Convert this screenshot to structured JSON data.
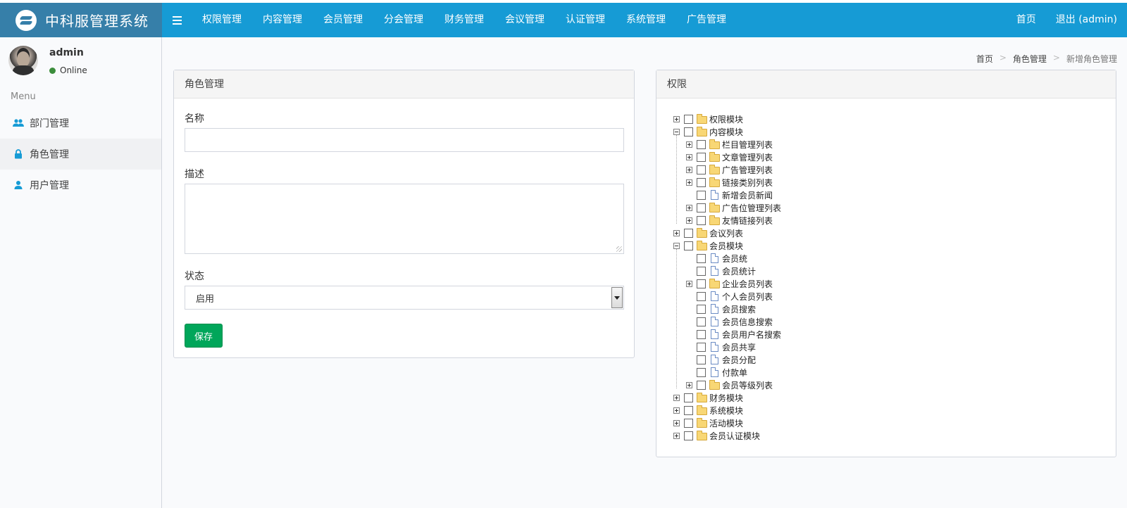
{
  "app": {
    "logo_text": "中科服管理系统"
  },
  "topnav": {
    "items": [
      "权限管理",
      "内容管理",
      "会员管理",
      "分会管理",
      "财务管理",
      "会议管理",
      "认证管理",
      "系统管理",
      "广告管理"
    ],
    "right": [
      "首页",
      "退出 (admin)"
    ]
  },
  "sidebar": {
    "user_name": "admin",
    "user_status": "Online",
    "menu_header": "Menu",
    "items": [
      {
        "label": "部门管理",
        "icon": "users-icon"
      },
      {
        "label": "角色管理",
        "icon": "lock-icon"
      },
      {
        "label": "用户管理",
        "icon": "user-icon"
      }
    ]
  },
  "breadcrumb": [
    "首页",
    "角色管理",
    "新增角色管理"
  ],
  "form": {
    "title": "角色管理",
    "name_label": "名称",
    "name_value": "",
    "desc_label": "描述",
    "desc_value": "",
    "status_label": "状态",
    "status_value": "启用",
    "save_label": "保存"
  },
  "permissions": {
    "title": "权限",
    "tree": [
      {
        "label": "权限模块",
        "type": "folder",
        "level": 0,
        "expander": "plus"
      },
      {
        "label": "内容模块",
        "type": "folder",
        "level": 0,
        "expander": "minus"
      },
      {
        "label": "栏目管理列表",
        "type": "folder",
        "level": 1,
        "expander": "plus"
      },
      {
        "label": "文章管理列表",
        "type": "folder",
        "level": 1,
        "expander": "plus"
      },
      {
        "label": "广告管理列表",
        "type": "folder",
        "level": 1,
        "expander": "plus"
      },
      {
        "label": "链接类别列表",
        "type": "folder",
        "level": 1,
        "expander": "plus"
      },
      {
        "label": "新增会员新闻",
        "type": "file",
        "level": 1,
        "expander": "none"
      },
      {
        "label": "广告位管理列表",
        "type": "folder",
        "level": 1,
        "expander": "plus"
      },
      {
        "label": "友情链接列表",
        "type": "folder",
        "level": 1,
        "expander": "plus"
      },
      {
        "label": "会议列表",
        "type": "folder",
        "level": 0,
        "expander": "plus"
      },
      {
        "label": "会员模块",
        "type": "folder",
        "level": 0,
        "expander": "minus"
      },
      {
        "label": "会员统",
        "type": "file",
        "level": 1,
        "expander": "none"
      },
      {
        "label": "会员统计",
        "type": "file",
        "level": 1,
        "expander": "none"
      },
      {
        "label": "企业会员列表",
        "type": "folder",
        "level": 1,
        "expander": "plus"
      },
      {
        "label": "个人会员列表",
        "type": "file",
        "level": 1,
        "expander": "none"
      },
      {
        "label": "会员搜索",
        "type": "file",
        "level": 1,
        "expander": "none"
      },
      {
        "label": "会员信息搜索",
        "type": "file",
        "level": 1,
        "expander": "none"
      },
      {
        "label": "会员用户名搜索",
        "type": "file",
        "level": 1,
        "expander": "none"
      },
      {
        "label": "会员共享",
        "type": "file",
        "level": 1,
        "expander": "none"
      },
      {
        "label": "会员分配",
        "type": "file",
        "level": 1,
        "expander": "none"
      },
      {
        "label": "付款单",
        "type": "file",
        "level": 1,
        "expander": "none"
      },
      {
        "label": "会员等级列表",
        "type": "folder",
        "level": 1,
        "expander": "plus"
      },
      {
        "label": "财务模块",
        "type": "folder",
        "level": 0,
        "expander": "plus"
      },
      {
        "label": "系统模块",
        "type": "folder",
        "level": 0,
        "expander": "plus"
      },
      {
        "label": "活动模块",
        "type": "folder",
        "level": 0,
        "expander": "plus"
      },
      {
        "label": "会员认证模块",
        "type": "folder",
        "level": 0,
        "expander": "plus"
      }
    ]
  },
  "colors": {
    "logo_bg": "#367fa9",
    "nav_bg": "#169bd5",
    "save_button": "#00a65a",
    "online_dot": "#3c8d3c"
  }
}
